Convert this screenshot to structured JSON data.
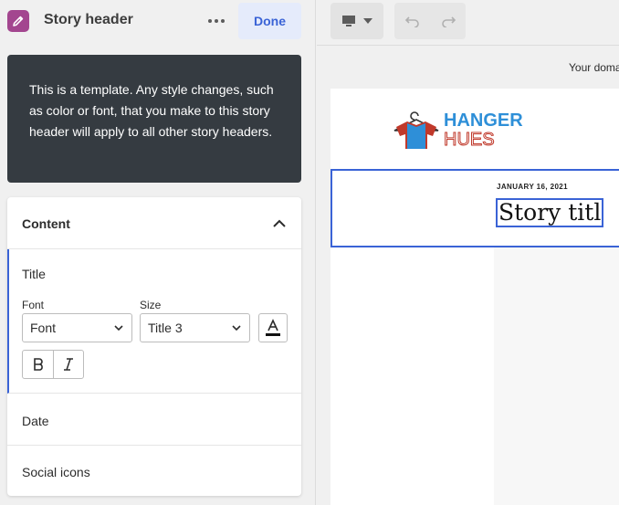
{
  "panel": {
    "title": "Story header",
    "more_icon": "more-horizontal-icon",
    "done_label": "Done"
  },
  "notice": {
    "text": "This is a template. Any style changes, such as color or font, that you make to this story header will apply to all other story headers."
  },
  "content": {
    "heading": "Content",
    "title_section": {
      "label": "Title",
      "font_label": "Font",
      "font_value": "Font",
      "size_label": "Size",
      "size_value": "Title 3"
    },
    "date_label": "Date",
    "social_label": "Social icons"
  },
  "editor": {
    "domain_text": "Your doma",
    "logo_line1": "HANGER",
    "logo_line2": "HUES",
    "story_date": "JANUARY 16, 2021",
    "story_title": "Story title"
  },
  "colors": {
    "accent": "#3a63d6",
    "brand_purple": "#a3468f",
    "notice_bg": "#353b41",
    "logo_blue": "#2e8fd8",
    "logo_red": "#c0392b"
  }
}
